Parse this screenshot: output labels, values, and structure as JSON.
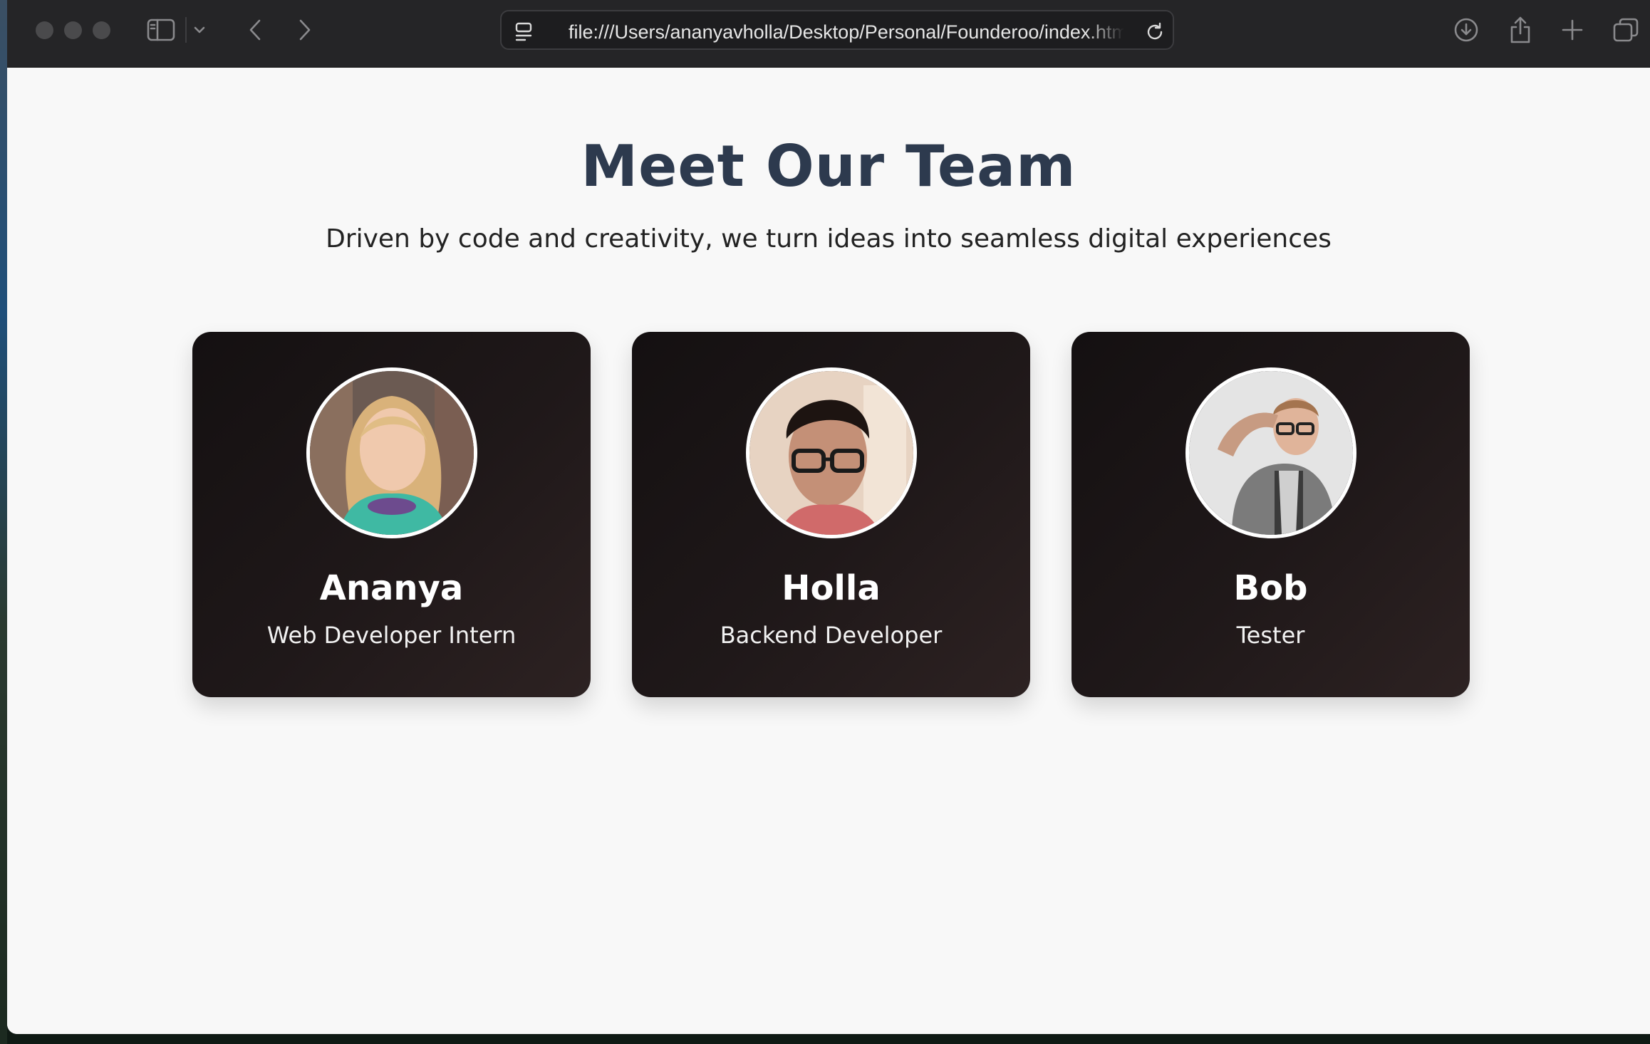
{
  "browser": {
    "url": "file:///Users/ananyavholla/Desktop/Personal/Founderoo/index.html"
  },
  "page": {
    "heading": "Meet Our Team",
    "subheading": "Driven by code and creativity, we turn ideas into seamless digital experiences"
  },
  "team": [
    {
      "name": "Ananya",
      "role": "Web Developer Intern"
    },
    {
      "name": "Holla",
      "role": "Backend Developer"
    },
    {
      "name": "Bob",
      "role": "Tester"
    }
  ],
  "icons": {
    "toolbar": [
      "sidebar-icon",
      "chevron-down-icon",
      "back-icon",
      "forward-icon",
      "page-menu-icon",
      "reload-icon",
      "download-icon",
      "share-icon",
      "new-tab-icon",
      "tab-overview-icon"
    ]
  }
}
